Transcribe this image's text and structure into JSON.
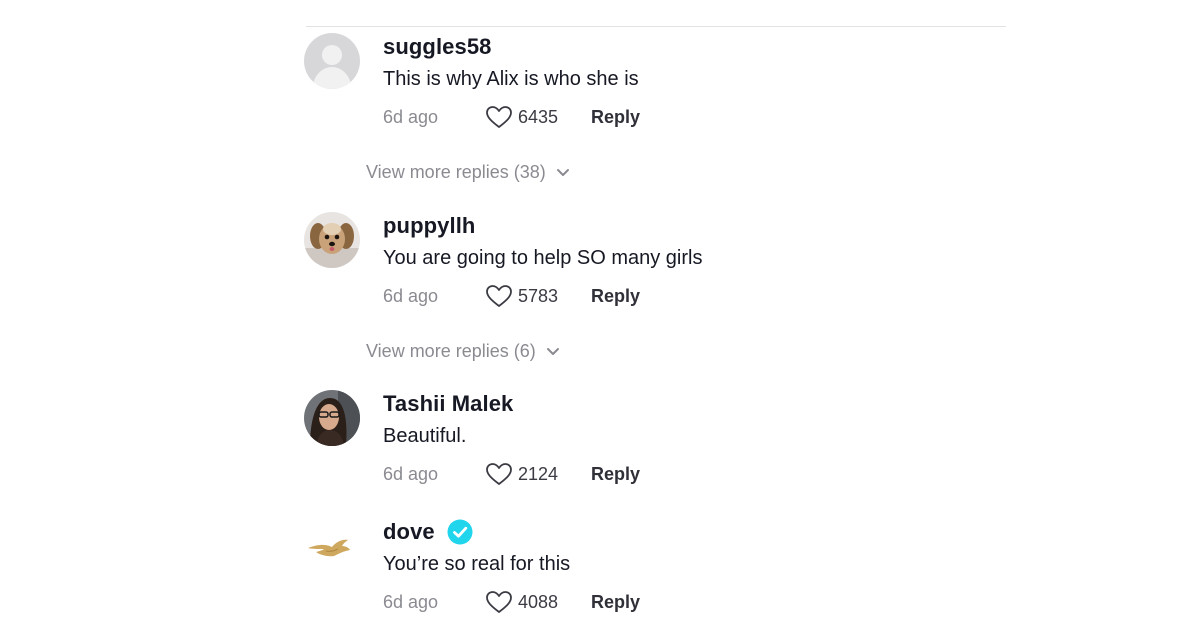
{
  "comments": [
    {
      "username": "suggles58",
      "text": "This is why Alix is who she is",
      "time": "6d ago",
      "likes": "6435",
      "reply_label": "Reply",
      "avatar": "default-avatar-icon",
      "verified": false
    },
    {
      "username": "puppyllh",
      "text": "You are going to help SO many girls",
      "time": "6d ago",
      "likes": "5783",
      "reply_label": "Reply",
      "avatar": "dog-photo",
      "verified": false
    },
    {
      "username": "Tashii Malek",
      "text": "Beautiful.",
      "time": "6d ago",
      "likes": "2124",
      "reply_label": "Reply",
      "avatar": "person-photo",
      "verified": false
    },
    {
      "username": "dove",
      "text": "You’re so real for this",
      "time": "6d ago",
      "likes": "4088",
      "reply_label": "Reply",
      "avatar": "dove-logo",
      "verified": true
    }
  ],
  "view_more": [
    "View more replies (38)",
    "View more replies (6)"
  ],
  "colors": {
    "text": "#161823",
    "muted": "#8a8b91",
    "verified": "#20d5ec",
    "divider": "#e3e3e4"
  }
}
